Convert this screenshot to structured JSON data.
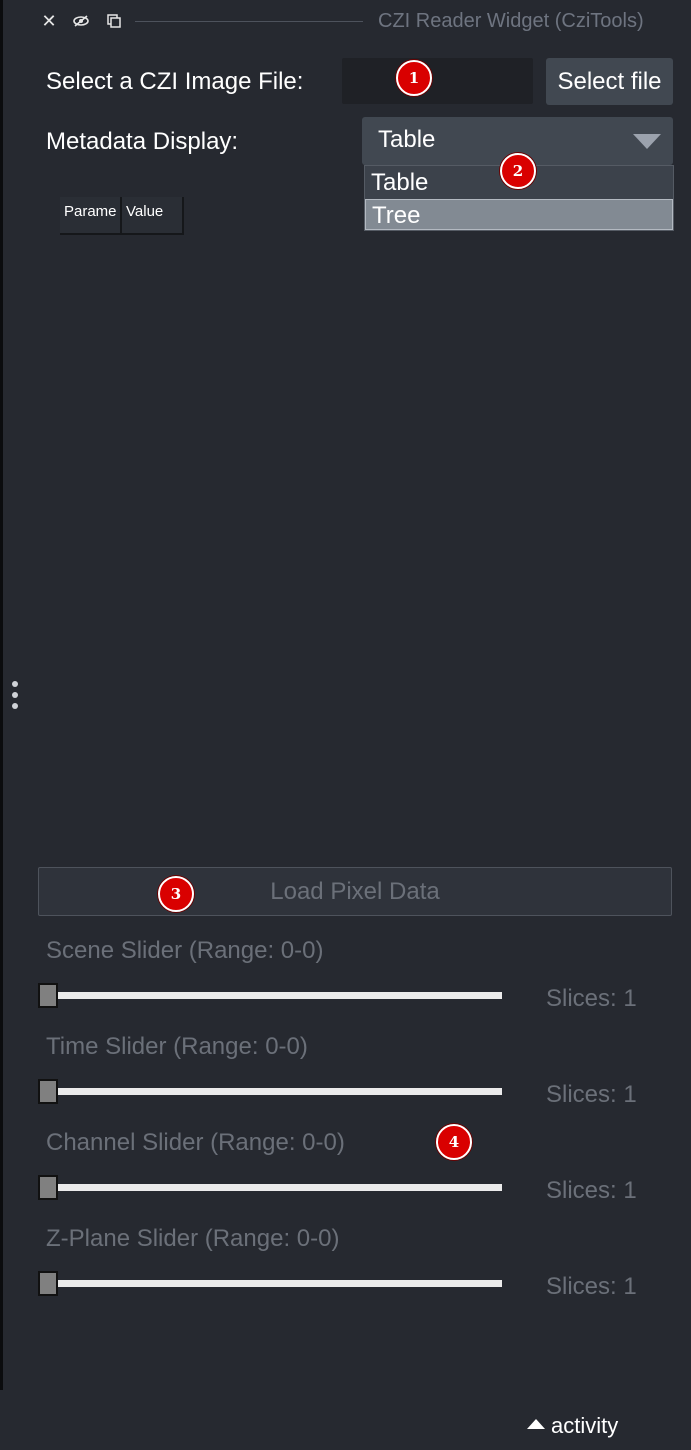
{
  "window": {
    "title": "CZI Reader Widget (CziTools)",
    "icons": {
      "close": "close-icon",
      "visibility": "eye-icon",
      "float": "float-icon"
    }
  },
  "file_select": {
    "label": "Select a CZI Image File:",
    "value": "",
    "button_label": "Select file"
  },
  "metadata": {
    "label": "Metadata Display:",
    "selected": "Table",
    "options": [
      "Table",
      "Tree"
    ],
    "highlighted_option": "Tree",
    "table_headers": [
      "Parame",
      "Value"
    ]
  },
  "load_button": {
    "label": "Load Pixel Data"
  },
  "sliders": [
    {
      "label": "Scene Slider (Range: 0-0)",
      "slices": "Slices: 1",
      "value": 0
    },
    {
      "label": "Time Slider (Range: 0-0)",
      "slices": "Slices: 1",
      "value": 0
    },
    {
      "label": "Channel Slider (Range: 0-0)",
      "slices": "Slices: 1",
      "value": 0
    },
    {
      "label": "Z-Plane Slider (Range: 0-0)",
      "slices": "Slices: 1",
      "value": 0
    }
  ],
  "annotations": [
    "1",
    "2",
    "3",
    "4"
  ],
  "activity": {
    "label": "activity",
    "icon": "caret-up-icon"
  },
  "colors": {
    "background": "#262930",
    "button": "#414851",
    "badge": "#d90000",
    "disabled_text": "#6b7079"
  }
}
